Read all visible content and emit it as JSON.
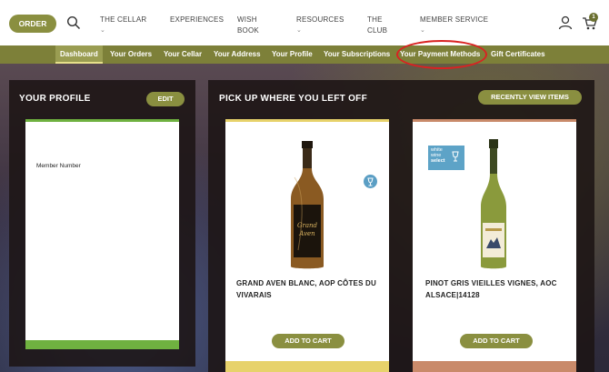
{
  "header": {
    "order_label": "ORDER",
    "nav": [
      {
        "label": "THE CELLAR",
        "chevron": true
      },
      {
        "label": "EXPERIENCES",
        "chevron": false
      },
      {
        "label": "WISH\nBOOK",
        "chevron": false
      },
      {
        "label": "RESOURCES",
        "chevron": true
      },
      {
        "label": "THE\nCLUB",
        "chevron": false
      },
      {
        "label": "MEMBER SERVICE",
        "chevron": true
      }
    ],
    "cart_count": "1",
    "icons": [
      "search-icon",
      "user-icon",
      "cart-icon",
      "chevron-down-icon"
    ]
  },
  "subnav": {
    "items": [
      {
        "label": "Dashboard",
        "active": true
      },
      {
        "label": "Your Orders"
      },
      {
        "label": "Your Cellar"
      },
      {
        "label": "Your Address"
      },
      {
        "label": "Your Profile"
      },
      {
        "label": "Your Subscriptions"
      },
      {
        "label": "Your Payment Methods",
        "highlighted": true
      },
      {
        "label": "Gift Certificates"
      }
    ]
  },
  "profile": {
    "title": "YOUR PROFILE",
    "edit_label": "EDIT",
    "member_number_label": "Member Number"
  },
  "recent": {
    "title": "PICK UP WHERE YOU LEFT OFF",
    "recently_viewed_label": "RECENTLY VIEW ITEMS",
    "products": [
      {
        "name_line1": "GRAND AVEN BLANC, AOP CÔTES DU",
        "name_line2": "VIVARAIS",
        "button": "ADD TO CART",
        "badge_icon": "wine-glass-icon"
      },
      {
        "name_line1": "PINOT GRIS VIEILLES VIGNES, AOC",
        "name_line2": "ALSACE|14128",
        "button": "ADD TO CART",
        "badge_text": [
          "white",
          "wine",
          "select"
        ]
      }
    ]
  },
  "colors": {
    "olive": "#8a8f40",
    "subnav": "#7d8039",
    "highlight_circle": "#d92222",
    "profile_accent": "#6fb140",
    "card1_accent": "#e7d26b",
    "card2_accent": "#c98a6a"
  }
}
